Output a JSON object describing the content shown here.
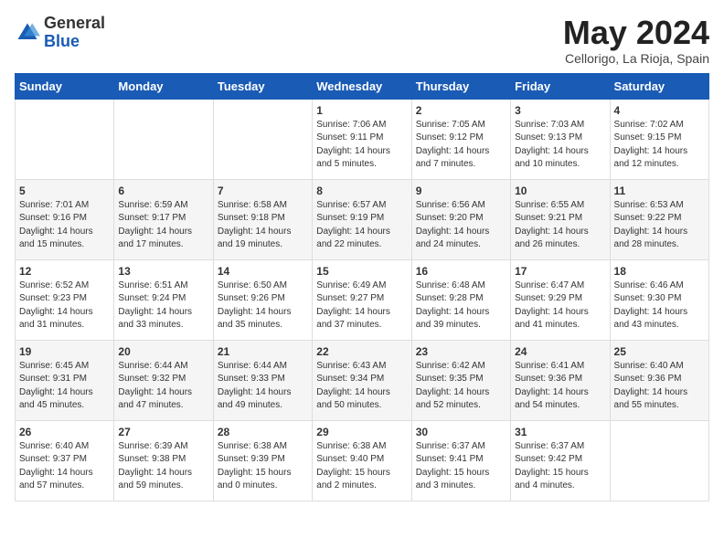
{
  "header": {
    "logo_general": "General",
    "logo_blue": "Blue",
    "month_title": "May 2024",
    "location": "Cellorigo, La Rioja, Spain"
  },
  "days_of_week": [
    "Sunday",
    "Monday",
    "Tuesday",
    "Wednesday",
    "Thursday",
    "Friday",
    "Saturday"
  ],
  "weeks": [
    [
      {
        "day": "",
        "info": ""
      },
      {
        "day": "",
        "info": ""
      },
      {
        "day": "",
        "info": ""
      },
      {
        "day": "1",
        "info": "Sunrise: 7:06 AM\nSunset: 9:11 PM\nDaylight: 14 hours\nand 5 minutes."
      },
      {
        "day": "2",
        "info": "Sunrise: 7:05 AM\nSunset: 9:12 PM\nDaylight: 14 hours\nand 7 minutes."
      },
      {
        "day": "3",
        "info": "Sunrise: 7:03 AM\nSunset: 9:13 PM\nDaylight: 14 hours\nand 10 minutes."
      },
      {
        "day": "4",
        "info": "Sunrise: 7:02 AM\nSunset: 9:15 PM\nDaylight: 14 hours\nand 12 minutes."
      }
    ],
    [
      {
        "day": "5",
        "info": "Sunrise: 7:01 AM\nSunset: 9:16 PM\nDaylight: 14 hours\nand 15 minutes."
      },
      {
        "day": "6",
        "info": "Sunrise: 6:59 AM\nSunset: 9:17 PM\nDaylight: 14 hours\nand 17 minutes."
      },
      {
        "day": "7",
        "info": "Sunrise: 6:58 AM\nSunset: 9:18 PM\nDaylight: 14 hours\nand 19 minutes."
      },
      {
        "day": "8",
        "info": "Sunrise: 6:57 AM\nSunset: 9:19 PM\nDaylight: 14 hours\nand 22 minutes."
      },
      {
        "day": "9",
        "info": "Sunrise: 6:56 AM\nSunset: 9:20 PM\nDaylight: 14 hours\nand 24 minutes."
      },
      {
        "day": "10",
        "info": "Sunrise: 6:55 AM\nSunset: 9:21 PM\nDaylight: 14 hours\nand 26 minutes."
      },
      {
        "day": "11",
        "info": "Sunrise: 6:53 AM\nSunset: 9:22 PM\nDaylight: 14 hours\nand 28 minutes."
      }
    ],
    [
      {
        "day": "12",
        "info": "Sunrise: 6:52 AM\nSunset: 9:23 PM\nDaylight: 14 hours\nand 31 minutes."
      },
      {
        "day": "13",
        "info": "Sunrise: 6:51 AM\nSunset: 9:24 PM\nDaylight: 14 hours\nand 33 minutes."
      },
      {
        "day": "14",
        "info": "Sunrise: 6:50 AM\nSunset: 9:26 PM\nDaylight: 14 hours\nand 35 minutes."
      },
      {
        "day": "15",
        "info": "Sunrise: 6:49 AM\nSunset: 9:27 PM\nDaylight: 14 hours\nand 37 minutes."
      },
      {
        "day": "16",
        "info": "Sunrise: 6:48 AM\nSunset: 9:28 PM\nDaylight: 14 hours\nand 39 minutes."
      },
      {
        "day": "17",
        "info": "Sunrise: 6:47 AM\nSunset: 9:29 PM\nDaylight: 14 hours\nand 41 minutes."
      },
      {
        "day": "18",
        "info": "Sunrise: 6:46 AM\nSunset: 9:30 PM\nDaylight: 14 hours\nand 43 minutes."
      }
    ],
    [
      {
        "day": "19",
        "info": "Sunrise: 6:45 AM\nSunset: 9:31 PM\nDaylight: 14 hours\nand 45 minutes."
      },
      {
        "day": "20",
        "info": "Sunrise: 6:44 AM\nSunset: 9:32 PM\nDaylight: 14 hours\nand 47 minutes."
      },
      {
        "day": "21",
        "info": "Sunrise: 6:44 AM\nSunset: 9:33 PM\nDaylight: 14 hours\nand 49 minutes."
      },
      {
        "day": "22",
        "info": "Sunrise: 6:43 AM\nSunset: 9:34 PM\nDaylight: 14 hours\nand 50 minutes."
      },
      {
        "day": "23",
        "info": "Sunrise: 6:42 AM\nSunset: 9:35 PM\nDaylight: 14 hours\nand 52 minutes."
      },
      {
        "day": "24",
        "info": "Sunrise: 6:41 AM\nSunset: 9:36 PM\nDaylight: 14 hours\nand 54 minutes."
      },
      {
        "day": "25",
        "info": "Sunrise: 6:40 AM\nSunset: 9:36 PM\nDaylight: 14 hours\nand 55 minutes."
      }
    ],
    [
      {
        "day": "26",
        "info": "Sunrise: 6:40 AM\nSunset: 9:37 PM\nDaylight: 14 hours\nand 57 minutes."
      },
      {
        "day": "27",
        "info": "Sunrise: 6:39 AM\nSunset: 9:38 PM\nDaylight: 14 hours\nand 59 minutes."
      },
      {
        "day": "28",
        "info": "Sunrise: 6:38 AM\nSunset: 9:39 PM\nDaylight: 15 hours\nand 0 minutes."
      },
      {
        "day": "29",
        "info": "Sunrise: 6:38 AM\nSunset: 9:40 PM\nDaylight: 15 hours\nand 2 minutes."
      },
      {
        "day": "30",
        "info": "Sunrise: 6:37 AM\nSunset: 9:41 PM\nDaylight: 15 hours\nand 3 minutes."
      },
      {
        "day": "31",
        "info": "Sunrise: 6:37 AM\nSunset: 9:42 PM\nDaylight: 15 hours\nand 4 minutes."
      },
      {
        "day": "",
        "info": ""
      }
    ]
  ]
}
